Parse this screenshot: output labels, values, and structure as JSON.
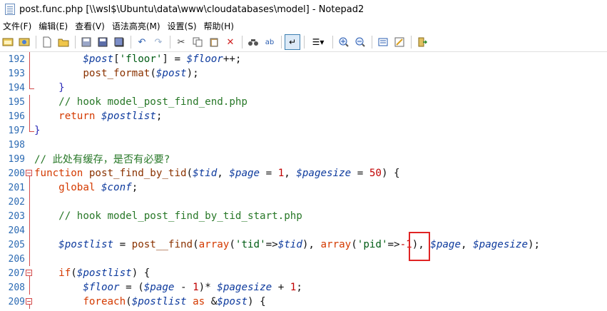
{
  "window": {
    "title": "post.func.php [\\\\wsl$\\Ubuntu\\data\\www\\cloudatabases\\model] - Notepad2"
  },
  "menu": [
    "文件(F)",
    "编辑(E)",
    "查看(V)",
    "语法高亮(M)",
    "设置(S)",
    "帮助(H)"
  ],
  "toolbar": {
    "icons": [
      "explorer-icon",
      "favorites-icon",
      "new-file-icon",
      "open-file-icon",
      "save-icon",
      "save-as-icon",
      "save-all-icon",
      "undo-icon",
      "redo-icon",
      "cut-icon",
      "copy-icon",
      "paste-icon",
      "delete-icon",
      "find-icon",
      "replace-icon",
      "word-wrap-icon",
      "scheme-icon",
      "zoom-in-icon",
      "zoom-out-icon",
      "settings-icon",
      "font-icon",
      "exit-icon"
    ]
  },
  "editor": {
    "lines": [
      {
        "num": "192",
        "fold": "line",
        "indent": "        ",
        "tokens": [
          [
            "var",
            "$post"
          ],
          [
            "plain",
            "["
          ],
          [
            "str",
            "'floor'"
          ],
          [
            "plain",
            "] = "
          ],
          [
            "var",
            "$floor"
          ],
          [
            "plain",
            "++;"
          ]
        ]
      },
      {
        "num": "193",
        "fold": "line",
        "indent": "        ",
        "tokens": [
          [
            "fn",
            "post_format"
          ],
          [
            "plain",
            "("
          ],
          [
            "var",
            "$post"
          ],
          [
            "plain",
            ");"
          ]
        ]
      },
      {
        "num": "194",
        "fold": "end",
        "indent": "    ",
        "tokens": [
          [
            "op",
            "}"
          ]
        ]
      },
      {
        "num": "195",
        "fold": "line",
        "indent": "    ",
        "tokens": [
          [
            "cm",
            "// hook model_post_find_end.php"
          ]
        ]
      },
      {
        "num": "196",
        "fold": "line",
        "indent": "    ",
        "tokens": [
          [
            "kw",
            "return "
          ],
          [
            "var",
            "$postlist"
          ],
          [
            "plain",
            ";"
          ]
        ]
      },
      {
        "num": "197",
        "fold": "end",
        "indent": "",
        "tokens": [
          [
            "op",
            "}"
          ]
        ]
      },
      {
        "num": "198",
        "fold": "none",
        "indent": "",
        "tokens": []
      },
      {
        "num": "199",
        "fold": "none",
        "indent": "",
        "tokens": [
          [
            "cm",
            "// 此处有缓存，是否有必要?"
          ]
        ]
      },
      {
        "num": "200",
        "fold": "box",
        "indent": "",
        "tokens": [
          [
            "kw",
            "function "
          ],
          [
            "fn",
            "post_find_by_tid"
          ],
          [
            "plain",
            "("
          ],
          [
            "var",
            "$tid"
          ],
          [
            "plain",
            ", "
          ],
          [
            "var",
            "$page"
          ],
          [
            "plain",
            " = "
          ],
          [
            "num",
            "1"
          ],
          [
            "plain",
            ", "
          ],
          [
            "var",
            "$pagesize"
          ],
          [
            "plain",
            " = "
          ],
          [
            "num",
            "50"
          ],
          [
            "plain",
            ") {"
          ]
        ]
      },
      {
        "num": "201",
        "fold": "line",
        "indent": "    ",
        "tokens": [
          [
            "kw",
            "global "
          ],
          [
            "var",
            "$conf"
          ],
          [
            "plain",
            ";"
          ]
        ]
      },
      {
        "num": "202",
        "fold": "line",
        "indent": "",
        "tokens": []
      },
      {
        "num": "203",
        "fold": "line",
        "indent": "    ",
        "tokens": [
          [
            "cm",
            "// hook model_post_find_by_tid_start.php"
          ]
        ]
      },
      {
        "num": "204",
        "fold": "line",
        "indent": "",
        "tokens": []
      },
      {
        "num": "205",
        "fold": "line",
        "indent": "    ",
        "tokens": [
          [
            "var",
            "$postlist"
          ],
          [
            "plain",
            " = "
          ],
          [
            "fn",
            "post__find"
          ],
          [
            "plain",
            "("
          ],
          [
            "kw",
            "array"
          ],
          [
            "plain",
            "("
          ],
          [
            "str",
            "'tid'"
          ],
          [
            "plain",
            "=>"
          ],
          [
            "var",
            "$tid"
          ],
          [
            "plain",
            "), "
          ],
          [
            "kw",
            "array"
          ],
          [
            "plain",
            "("
          ],
          [
            "str",
            "'pid'"
          ],
          [
            "plain",
            "=>"
          ],
          [
            "num",
            "-1"
          ],
          [
            "plain",
            "), "
          ],
          [
            "var",
            "$page"
          ],
          [
            "plain",
            ", "
          ],
          [
            "var",
            "$pagesize"
          ],
          [
            "plain",
            ");"
          ]
        ]
      },
      {
        "num": "206",
        "fold": "line",
        "indent": "",
        "tokens": []
      },
      {
        "num": "207",
        "fold": "box",
        "indent": "    ",
        "tokens": [
          [
            "kw",
            "if"
          ],
          [
            "plain",
            "("
          ],
          [
            "var",
            "$postlist"
          ],
          [
            "plain",
            ") {"
          ]
        ]
      },
      {
        "num": "208",
        "fold": "line",
        "indent": "        ",
        "tokens": [
          [
            "var",
            "$floor"
          ],
          [
            "plain",
            " = ("
          ],
          [
            "var",
            "$page"
          ],
          [
            "plain",
            " - "
          ],
          [
            "num",
            "1"
          ],
          [
            "plain",
            ")* "
          ],
          [
            "var",
            "$pagesize"
          ],
          [
            "plain",
            " + "
          ],
          [
            "num",
            "1"
          ],
          [
            "plain",
            ";"
          ]
        ]
      },
      {
        "num": "209",
        "fold": "box",
        "indent": "        ",
        "tokens": [
          [
            "kw",
            "foreach"
          ],
          [
            "plain",
            "("
          ],
          [
            "var",
            "$postlist"
          ],
          [
            "kw",
            " as "
          ],
          [
            "plain",
            "&"
          ],
          [
            "var",
            "$post"
          ],
          [
            "plain",
            ") {"
          ]
        ]
      }
    ]
  }
}
